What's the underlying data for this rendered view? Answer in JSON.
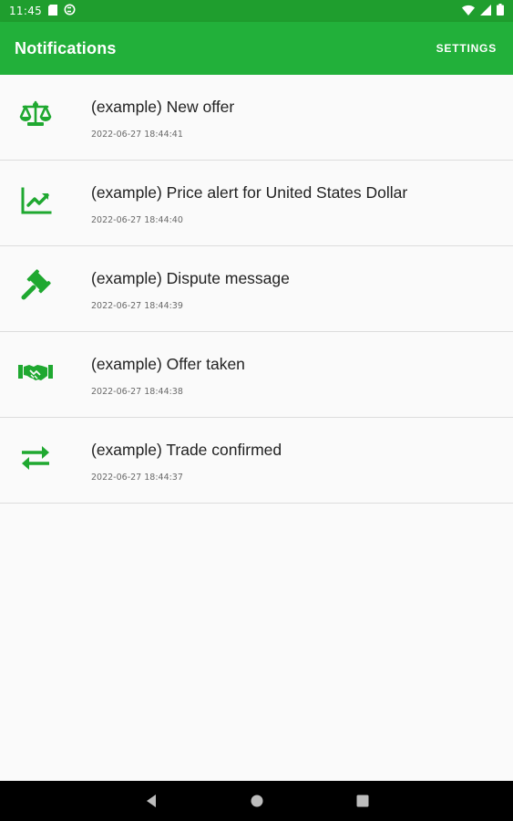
{
  "status_bar": {
    "time": "11:45",
    "icons": [
      "sd-card-icon",
      "sync-icon",
      "wifi-icon",
      "signal-icon",
      "battery-icon"
    ]
  },
  "app_bar": {
    "title": "Notifications",
    "action_label": "SETTINGS"
  },
  "colors": {
    "primary": "#22b03a",
    "status_bar": "#1f9e2e",
    "icon_green": "#1fa830",
    "background": "#fafafa"
  },
  "notifications": [
    {
      "icon": "scale-icon",
      "title": "(example) New offer",
      "time": "2022-06-27 18:44:41"
    },
    {
      "icon": "trending-up-icon",
      "title": "(example) Price alert for United States Dollar",
      "time": "2022-06-27 18:44:40"
    },
    {
      "icon": "gavel-icon",
      "title": "(example) Dispute message",
      "time": "2022-06-27 18:44:39"
    },
    {
      "icon": "handshake-icon",
      "title": "(example) Offer taken",
      "time": "2022-06-27 18:44:38"
    },
    {
      "icon": "swap-arrows-icon",
      "title": "(example) Trade confirmed",
      "time": "2022-06-27 18:44:37"
    }
  ],
  "nav_bar": {
    "icons": [
      "back-icon",
      "home-icon",
      "recents-icon"
    ]
  }
}
